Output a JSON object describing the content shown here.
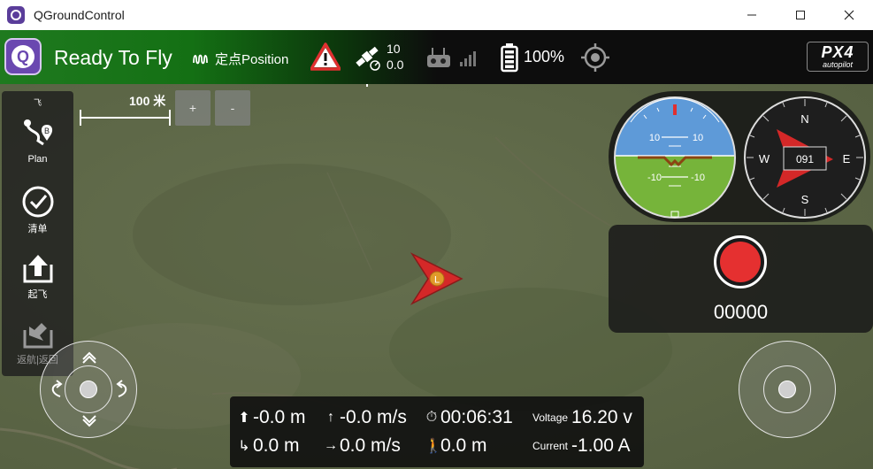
{
  "window": {
    "title": "QGroundControl"
  },
  "toolbar": {
    "status": "Ready To Fly",
    "flight_mode": "定点Position",
    "gps": {
      "satellites": "10",
      "hdop": "0.0"
    },
    "battery": "100%",
    "logo": {
      "main": "PX4",
      "sub": "autopilot"
    }
  },
  "toolstrip": {
    "top_label": "飞",
    "items": [
      {
        "label": "Plan",
        "icon": "plan-route-icon"
      },
      {
        "label": "清单",
        "icon": "checklist-icon"
      },
      {
        "label": "起飞",
        "icon": "takeoff-icon"
      },
      {
        "label": "返航|返回",
        "icon": "return-icon"
      }
    ]
  },
  "map": {
    "scale_label": "100 米",
    "zoom_in": "+",
    "zoom_out": "-",
    "vehicle_badge": "L"
  },
  "instruments": {
    "attitude_labels": {
      "up": "10",
      "down": "-10"
    },
    "heading": "091",
    "compass": {
      "n": "N",
      "e": "E",
      "s": "S",
      "w": "W"
    }
  },
  "camera": {
    "record_count": "00000"
  },
  "telemetry": {
    "altitude_rel": "-0.0 m",
    "vertical_speed": "-0.0 m/s",
    "flight_time": "00:06:31",
    "voltage_label": "Voltage",
    "voltage": "16.20 v",
    "distance_home": "0.0 m",
    "ground_speed": "0.0 m/s",
    "distance": "0.0 m",
    "current_label": "Current",
    "current": "-1.00 A"
  },
  "colors": {
    "ready_green": "#147014",
    "record_red": "#e53030",
    "vehicle_red": "#d42828",
    "sky_blue": "#5e9ad8",
    "ground_green": "#76b43a"
  }
}
